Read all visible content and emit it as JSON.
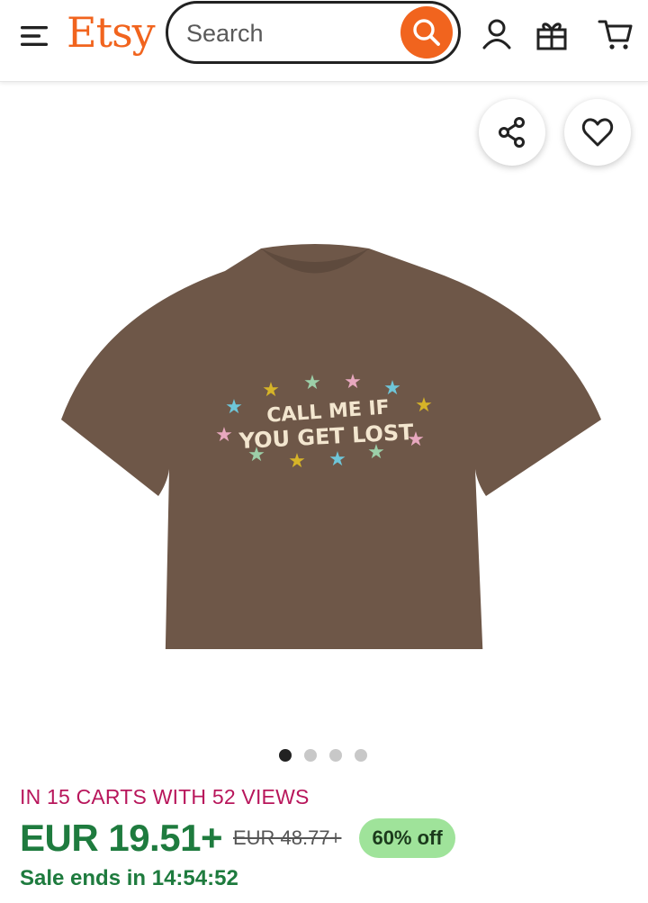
{
  "header": {
    "logo": "Etsy",
    "search_placeholder": "Search",
    "icons": [
      "menu-icon",
      "search-icon",
      "account-icon",
      "gift-icon",
      "cart-icon"
    ]
  },
  "product_image": {
    "shirt_text_line1": "CALL ME IF",
    "shirt_text_line2": "YOU GET LOST",
    "shirt_color": "#6E5748",
    "actions": [
      "share-icon",
      "favorite-heart-icon"
    ]
  },
  "gallery": {
    "total_images": 4,
    "active_index": 0
  },
  "listing": {
    "cart_note": "IN 15 CARTS WITH 52 VIEWS",
    "price": "EUR 19.51+",
    "original_price": "EUR 48.77+",
    "discount": "60% off",
    "sale_ends": "Sale ends in 14:54:52"
  },
  "colors": {
    "brand": "#F1641E",
    "price_green": "#1E7B3E",
    "cart_note": "#B8165B",
    "discount_badge": "#9FE39A"
  }
}
